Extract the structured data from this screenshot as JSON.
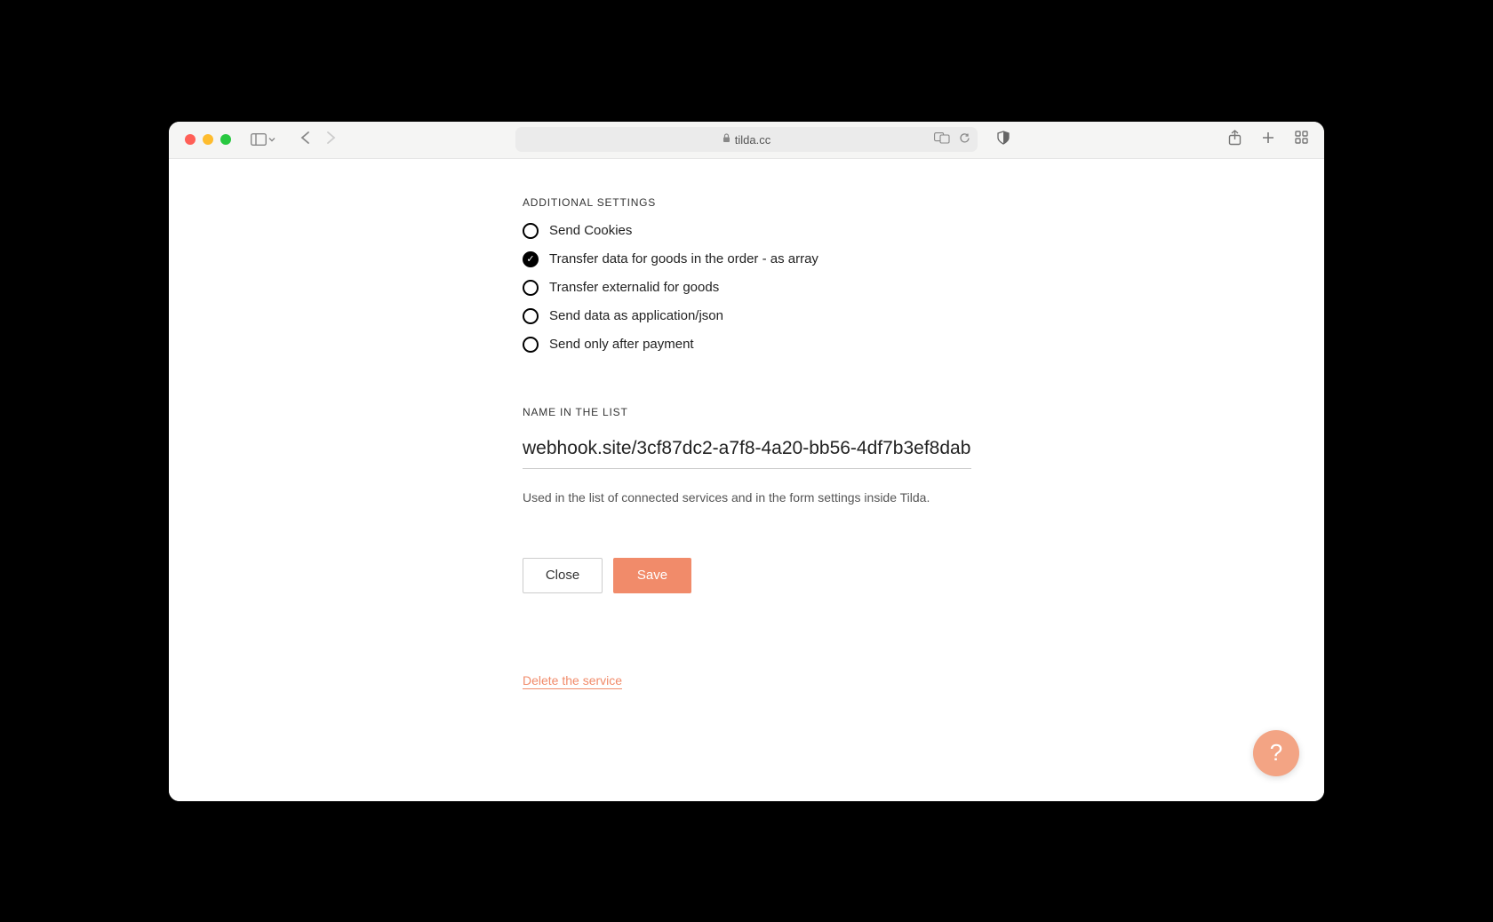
{
  "browser": {
    "url_display": "tilda.cc"
  },
  "settings": {
    "section_label": "ADDITIONAL SETTINGS",
    "checkboxes": [
      {
        "label": "Send Cookies",
        "checked": false
      },
      {
        "label": "Transfer data for goods in the order - as array",
        "checked": true
      },
      {
        "label": "Transfer externalid for goods",
        "checked": false
      },
      {
        "label": "Send data as application/json",
        "checked": false
      },
      {
        "label": "Send only after payment",
        "checked": false
      }
    ]
  },
  "name_field": {
    "label": "NAME IN THE LIST",
    "value": "webhook.site/3cf87dc2-a7f8-4a20-bb56-4df7b3ef8dab",
    "help": "Used in the list of connected services and in the form settings inside Tilda."
  },
  "buttons": {
    "close": "Close",
    "save": "Save"
  },
  "delete_link": "Delete the service",
  "help_fab": "?"
}
